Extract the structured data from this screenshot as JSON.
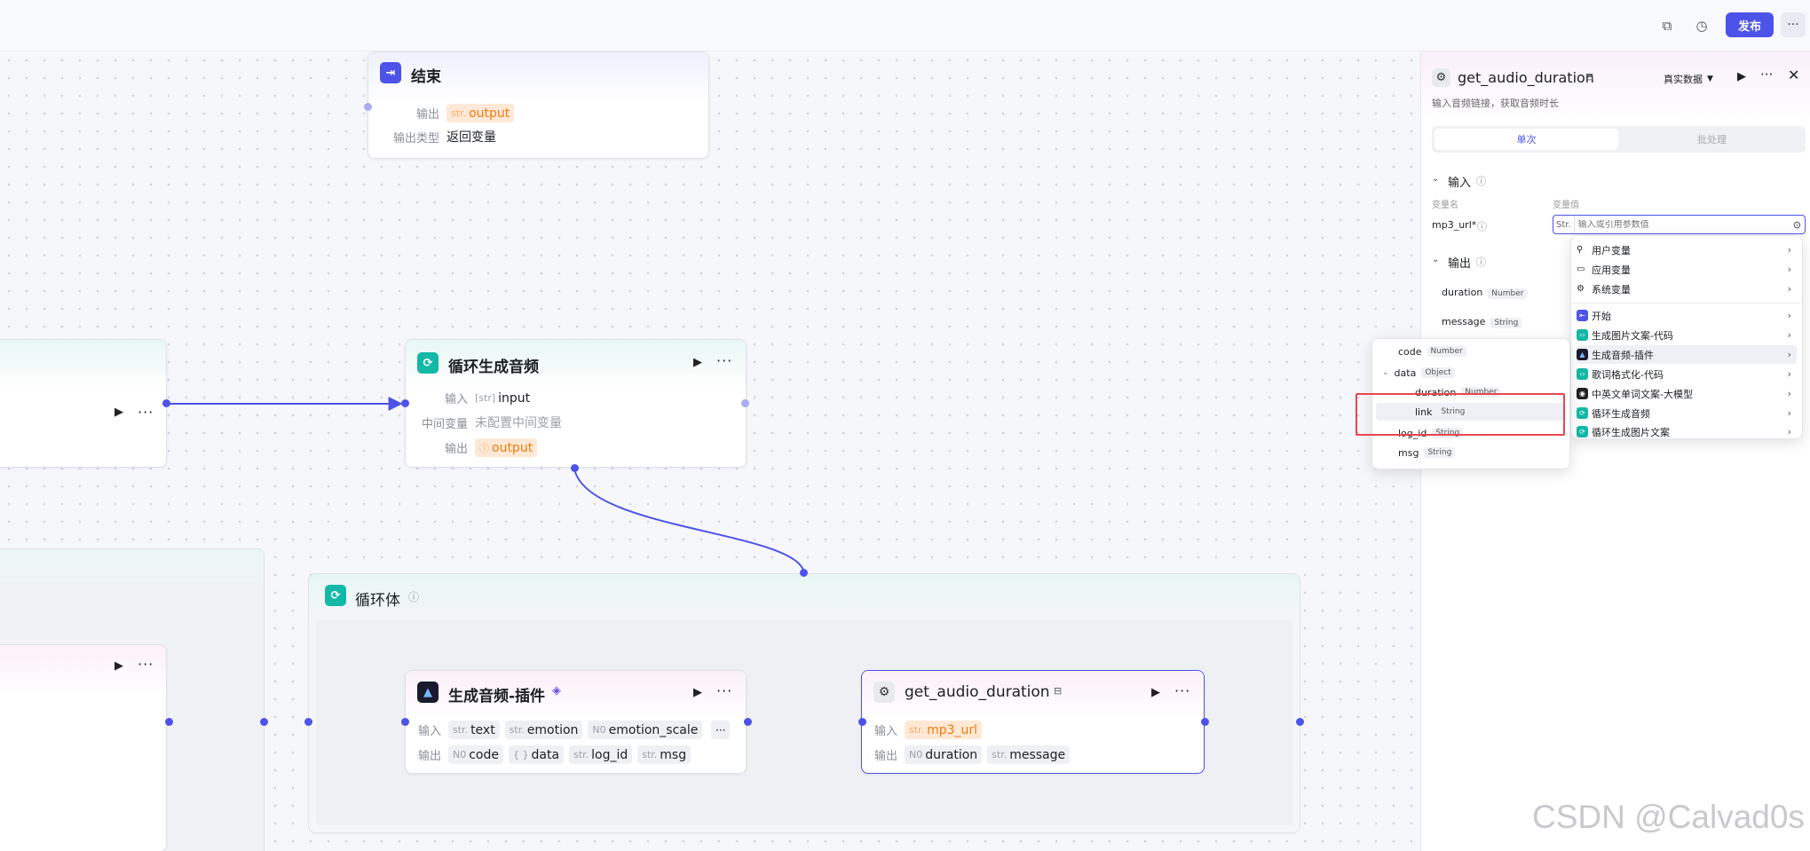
{
  "topbar": {
    "icons": [
      "copy-icon",
      "history-icon"
    ],
    "publish_label": "发布",
    "more_label": "···"
  },
  "canvas": {
    "end_node": {
      "title": "结束",
      "output_label": "输出",
      "output_type_tag": "str.",
      "output_var": "output",
      "output_type_label": "输出类型",
      "output_type_value": "返回变量"
    },
    "left_node_top": {
      "more": "···"
    },
    "loop_node": {
      "title": "循环生成音频",
      "input_label": "输入",
      "input_tag": "[str]",
      "input_var": "input",
      "mid_label": "中间变量",
      "mid_value": "未配置中间变量",
      "output_label": "输出",
      "output_tag": "ⓘ",
      "output_var": "output",
      "more": "···"
    },
    "loop_body": {
      "title": "循环体"
    },
    "left_node_bottom": {
      "more": "···"
    },
    "audio_plugin_node": {
      "title": "生成音频-插件",
      "input_label": "输入",
      "inputs": [
        {
          "t": "str.",
          "name": "text"
        },
        {
          "t": "str.",
          "name": "emotion"
        },
        {
          "t": "N0",
          "name": "emotion_scale"
        }
      ],
      "output_label": "输出",
      "outputs": [
        {
          "t": "N0",
          "name": "code"
        },
        {
          "t": "{ }",
          "name": "data"
        },
        {
          "t": "str.",
          "name": "log_id"
        },
        {
          "t": "str.",
          "name": "msg"
        }
      ],
      "more": "···",
      "inputs_more": "···"
    },
    "duration_node": {
      "title": "get_audio_duration",
      "input_label": "输入",
      "input_tag": "str.",
      "input_var": "mp3_url",
      "output_label": "输出",
      "outputs": [
        {
          "t": "N0",
          "name": "duration"
        },
        {
          "t": "str.",
          "name": "message"
        }
      ],
      "more": "···"
    }
  },
  "panel": {
    "title": "get_audio_duration",
    "data_mode": "真实数据",
    "description": "输入音频链接，获取音频时长",
    "tabs": {
      "single": "单次",
      "batch": "批处理"
    },
    "input_section": "输入",
    "col_name": "变量名",
    "col_value": "变量值",
    "param_name": "mp3_url*",
    "param_type": "Str.",
    "param_placeholder": "输入或引用参数值",
    "output_section": "输出",
    "outputs": [
      {
        "name": "duration",
        "type": "Number"
      },
      {
        "name": "message",
        "type": "String"
      }
    ]
  },
  "ref_menu": {
    "items": [
      {
        "label": "用户变量",
        "icon": "user-icon"
      },
      {
        "label": "应用变量",
        "icon": "folder-icon"
      },
      {
        "label": "系统变量",
        "icon": "gear-icon"
      },
      {
        "label": "开始",
        "icon": "start-node-icon"
      },
      {
        "label": "生成图片文案-代码",
        "icon": "code-node-icon"
      },
      {
        "label": "生成音频-插件",
        "icon": "plugin-node-icon"
      },
      {
        "label": "歌词格式化-代码",
        "icon": "code-node-icon"
      },
      {
        "label": "中英文单词文案-大模型",
        "icon": "llm-node-icon"
      },
      {
        "label": "循环生成音频",
        "icon": "loop-node-icon"
      },
      {
        "label": "循环生成图片文案",
        "icon": "loop-node-icon"
      }
    ]
  },
  "sub_menu": {
    "items": [
      {
        "name": "code",
        "type": "Number"
      },
      {
        "name": "data",
        "type": "Object"
      },
      {
        "name": "duration",
        "type": "Number"
      },
      {
        "name": "link",
        "type": "String"
      },
      {
        "name": "log_id",
        "type": "String"
      },
      {
        "name": "msg",
        "type": "String"
      }
    ]
  },
  "watermark": "CSDN @Calvad0s",
  "colors": {
    "accent": "#4d53e8",
    "highlight": "#e8474f",
    "orange": "#f27a0c",
    "teal": "#14b8a6"
  }
}
